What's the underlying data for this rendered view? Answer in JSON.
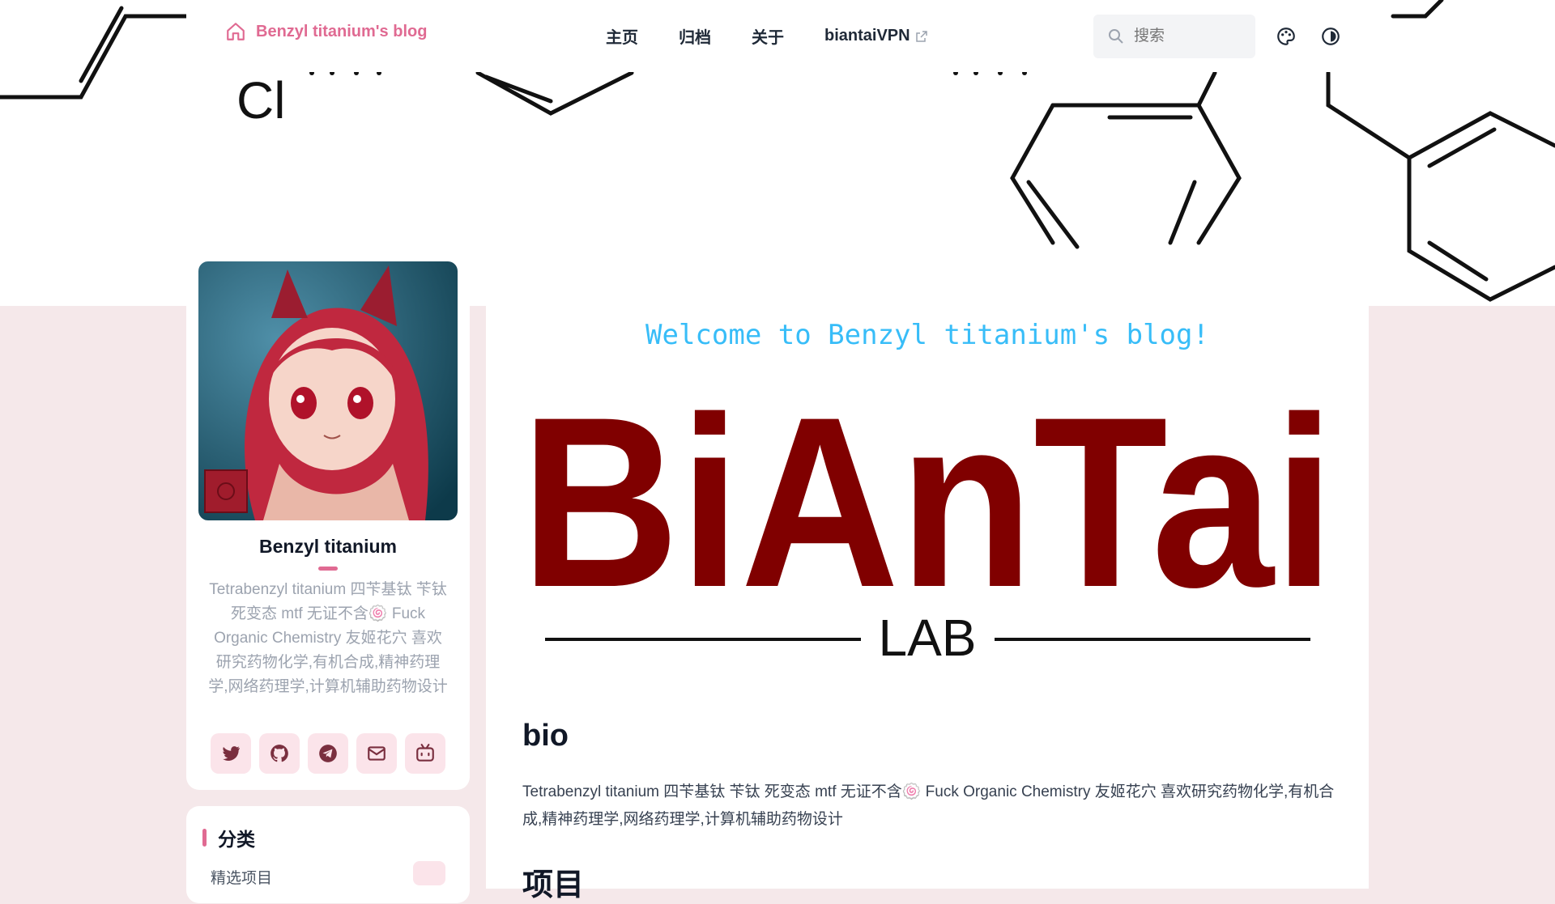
{
  "nav": {
    "brand": "Benzyl titanium's blog",
    "links": [
      "主页",
      "归档",
      "关于",
      "biantaiVPN"
    ],
    "search_placeholder": "搜索"
  },
  "banner": {
    "atom_label": "Cl"
  },
  "profile": {
    "name": "Benzyl titanium",
    "bio": "Tetrabenzyl titanium 四苄基钛 苄钛 死变态 mtf 无证不含🍥 Fuck Organic Chemistry 友姬花穴 喜欢研究药物化学,有机合成,精神药理学,网络药理学,计算机辅助药物设计",
    "socials": [
      "twitter-icon",
      "github-icon",
      "telegram-icon",
      "mail-icon",
      "bilibili-icon"
    ]
  },
  "categories": {
    "title": "分类",
    "first_item": "精选项目"
  },
  "main": {
    "welcome": "Welcome to Benzyl titanium's blog!",
    "logo_text": "BiAnTai",
    "logo_sub": "LAB",
    "bio_heading": "bio",
    "bio_text": "Tetrabenzyl titanium 四苄基钛 苄钛 死变态 mtf 无证不含🍥 Fuck Organic Chemistry 友姬花穴 喜欢研究药物化学,有机合成,精神药理学,网络药理学,计算机辅助药物设计",
    "next_heading": "项目"
  },
  "colors": {
    "accent": "#e06a92",
    "logo": "#800000",
    "welcome": "#38bdf8"
  }
}
